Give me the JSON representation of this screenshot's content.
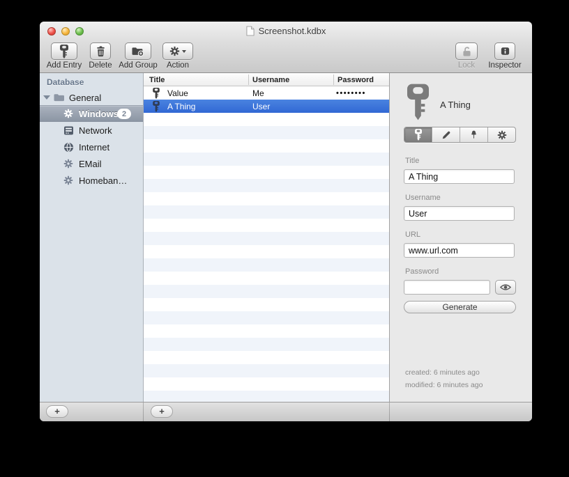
{
  "window": {
    "title": "Screenshot.kdbx"
  },
  "toolbar": {
    "items": [
      {
        "label": "Add Entry",
        "icon": "key-icon"
      },
      {
        "label": "Delete",
        "icon": "trash-icon"
      },
      {
        "label": "Add Group",
        "icon": "add-folder-icon"
      },
      {
        "label": "Action",
        "icon": "gear-menu-icon"
      }
    ],
    "lock": {
      "label": "Lock",
      "icon": "unlocked-padlock-icon",
      "enabled": false
    },
    "inspector": {
      "label": "Inspector",
      "icon": "info-icon"
    }
  },
  "sidebar": {
    "header": "Database",
    "tree": [
      {
        "label": "General",
        "icon": "folder-icon",
        "expanded": true
      },
      {
        "label": "Windows",
        "icon": "gear-icon",
        "badge": "2",
        "selected": true
      },
      {
        "label": "Network",
        "icon": "server-icon"
      },
      {
        "label": "Internet",
        "icon": "globe-icon"
      },
      {
        "label": "EMail",
        "icon": "gear-icon"
      },
      {
        "label": "Homeban…",
        "icon": "gear-icon"
      }
    ],
    "add_button_label": "+"
  },
  "entry_table": {
    "columns": [
      "Title",
      "Username",
      "Password"
    ],
    "rows": [
      {
        "title": "Value",
        "username": "Me",
        "password_mask": "••••••••",
        "selected": false
      },
      {
        "title": "A Thing",
        "username": "User",
        "password_mask": "",
        "selected": true
      }
    ],
    "add_button_label": "+"
  },
  "inspector": {
    "entry_title": "A Thing",
    "tabs": [
      {
        "icon": "key-icon",
        "selected": true
      },
      {
        "icon": "pencil-icon",
        "selected": false
      },
      {
        "icon": "pushpin-icon",
        "selected": false
      },
      {
        "icon": "gear-icon",
        "selected": false
      }
    ],
    "title_field": {
      "label": "Title",
      "value": "A Thing"
    },
    "username_field": {
      "label": "Username",
      "value": "User"
    },
    "url_field": {
      "label": "URL",
      "value": "www.url.com"
    },
    "password_field": {
      "label": "Password",
      "value": ""
    },
    "generate_button_label": "Generate",
    "created": "created: 6 minutes ago",
    "modified": "modified: 6 minutes ago"
  },
  "colors": {
    "table_selection_blue": "#3b74d8",
    "sidebar_selection_gray": "#97a1ae",
    "sidebar_background": "#dbe2e9",
    "inspector_background": "#e9e9e9"
  }
}
